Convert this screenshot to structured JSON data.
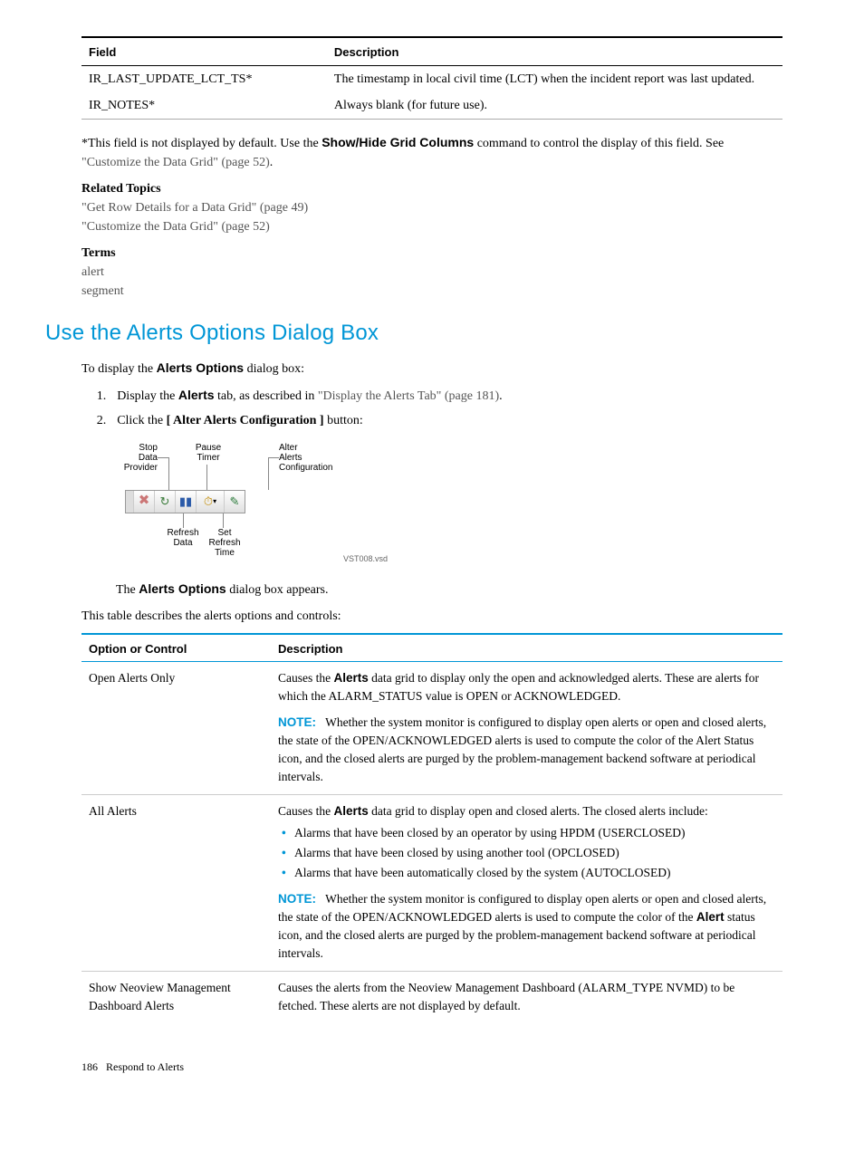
{
  "table1": {
    "headers": {
      "field": "Field",
      "description": "Description"
    },
    "rows": [
      {
        "field": "IR_LAST_UPDATE_LCT_TS*",
        "desc": "The timestamp in local civil time (LCT) when the incident report was last updated."
      },
      {
        "field": "IR_NOTES*",
        "desc": "Always blank (for future use)."
      }
    ]
  },
  "note_text_pre": "*This field is not displayed by default. Use the ",
  "note_bold": "Show/Hide Grid Columns",
  "note_text_mid": " command to control the display of this field. See ",
  "note_link": "\"Customize the Data Grid\" (page 52)",
  "note_text_end": ".",
  "related_topics_label": "Related Topics",
  "related_links": [
    "\"Get Row Details for a Data Grid\" (page 49)",
    "\"Customize the Data Grid\" (page 52)"
  ],
  "terms_label": "Terms",
  "terms": [
    "alert",
    "segment"
  ],
  "section_heading": "Use the Alerts Options Dialog Box",
  "intro_text_pre": "To display the ",
  "intro_bold": "Alerts Options",
  "intro_text_post": " dialog box:",
  "steps": {
    "step1_pre": "Display the ",
    "step1_bold": "Alerts",
    "step1_mid": " tab, as described in ",
    "step1_link": "\"Display the Alerts Tab\" (page 181)",
    "step1_end": ".",
    "step2_pre": "Click the ",
    "step2_bold": "[ Alter Alerts Configuration ]",
    "step2_end": " button:"
  },
  "diagram": {
    "stop_label": "Stop\nData\nProvider",
    "pause_label": "Pause\nTimer",
    "alter_label": "Alter\nAlerts\nConfiguration",
    "refresh_data_label": "Refresh\nData",
    "set_refresh_label": "Set\nRefresh\nTime",
    "vst_label": "VST008.vsd"
  },
  "dialog_appears_pre": "The ",
  "dialog_appears_bold": "Alerts Options",
  "dialog_appears_post": " dialog box appears.",
  "table_intro": "This table describes the alerts options and controls:",
  "table2": {
    "headers": {
      "option": "Option or Control",
      "description": "Description"
    },
    "rows": [
      {
        "option": "Open Alerts Only",
        "desc_pre": "Causes the ",
        "desc_bold": "Alerts",
        "desc_post": " data grid to display only the open and acknowledged alerts. These are alerts for which the ALARM_STATUS value is OPEN or ACKNOWLEDGED.",
        "note_label": "NOTE:",
        "note_text": "Whether the system monitor is configured to display open alerts or open and closed alerts, the state of the OPEN/ACKNOWLEDGED alerts is used to compute the color of the Alert Status icon, and the closed alerts are purged by the problem-management backend software at periodical intervals."
      },
      {
        "option": "All Alerts",
        "desc_pre": "Causes the ",
        "desc_bold": "Alerts",
        "desc_post": " data grid to display open and closed alerts. The closed alerts include:",
        "bullets": [
          "Alarms that have been closed by an operator by using HPDM (USERCLOSED)",
          "Alarms that have been closed by using another tool (OPCLOSED)",
          "Alarms that have been automatically closed by the system (AUTOCLOSED)"
        ],
        "note_label": "NOTE:",
        "note_pre": "Whether the system monitor is configured to display open alerts or open and closed alerts, the state of the OPEN/ACKNOWLEDGED alerts is used to compute the color of the ",
        "note_bold": "Alert",
        "note_post": " status icon, and the closed alerts are purged by the problem-management backend software at periodical intervals."
      },
      {
        "option": "Show Neoview Management Dashboard Alerts",
        "desc": "Causes the alerts from the Neoview Management Dashboard (ALARM_TYPE NVMD) to be fetched. These alerts are not displayed by default."
      }
    ]
  },
  "footer": {
    "page": "186",
    "title": "Respond to Alerts"
  }
}
